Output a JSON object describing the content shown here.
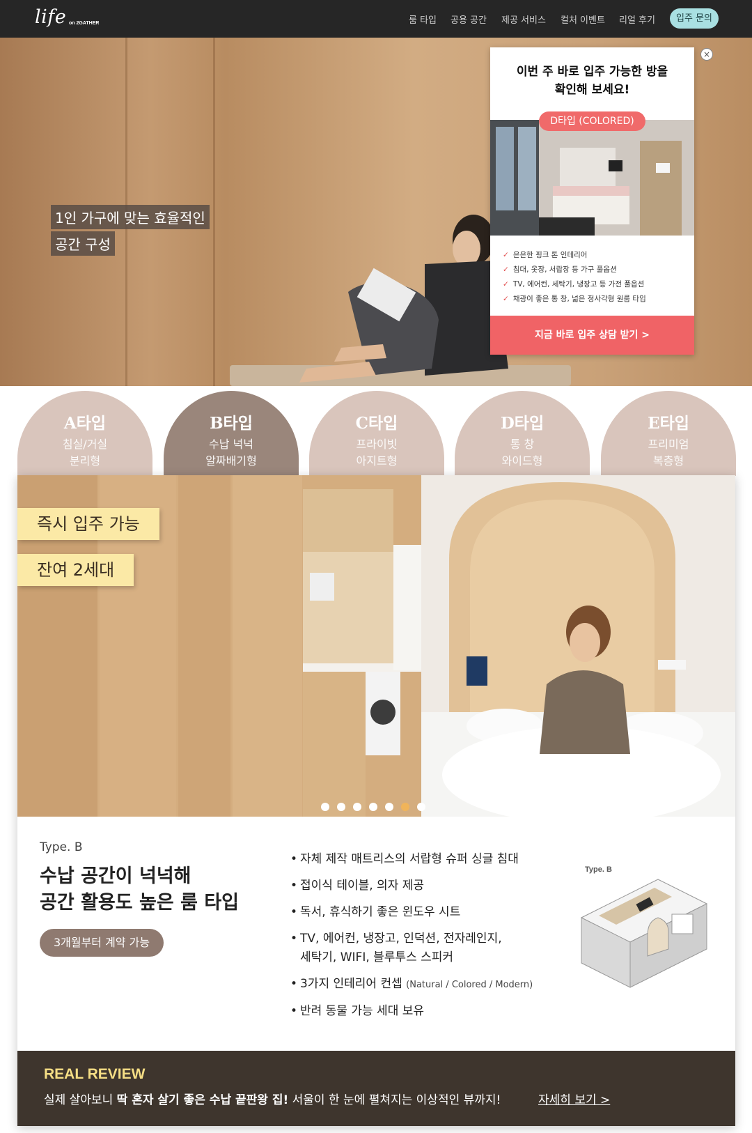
{
  "nav": {
    "logo": "life",
    "logo_sub": "on 2GATHER",
    "items": [
      "룸 타입",
      "공용 공간",
      "제공 서비스",
      "컬처 이벤트",
      "리얼 후기"
    ],
    "cta": "입주 문의"
  },
  "hero": {
    "caption_line1": "1인 가구에 맞는 효율적인",
    "caption_line2": "공간 구성"
  },
  "popup": {
    "close": "×",
    "title_line1": "이번 주 바로 입주 가능한 방을",
    "title_line2": "확인해 보세요!",
    "badge": "D타입 (COLORED)",
    "checks": [
      "은은한 핑크 톤 인테리어",
      "침대, 옷장, 서랍장 등 가구 풀옵션",
      "TV, 에어컨, 세탁기, 냉장고 등 가전 풀옵션",
      "채광이 좋은 통 창, 넓은 정사각형 원룸 타입"
    ],
    "cta": "지금 바로 입주 상담 받기 >"
  },
  "tabs": [
    {
      "title": "A타입",
      "line1": "침실/거실",
      "line2": "분리형",
      "color": "#d9c5bc",
      "active": false
    },
    {
      "title": "B타입",
      "line1": "수납 넉넉",
      "line2": "알짜배기형",
      "color": "#9a867b",
      "active": true
    },
    {
      "title": "C타입",
      "line1": "프라이빗",
      "line2": "아지트형",
      "color": "#d9c5bc",
      "active": false
    },
    {
      "title": "D타입",
      "line1": "통 창",
      "line2": "와이드형",
      "color": "#d9c5bc",
      "active": false
    },
    {
      "title": "E타입",
      "line1": "프리미엄",
      "line2": "복층형",
      "color": "#d9c5bc",
      "active": false
    }
  ],
  "slide": {
    "badge1": "즉시 입주 가능",
    "badge2": "잔여 2세대",
    "dots_total": 7,
    "active_dot": 6
  },
  "detail": {
    "type_label": "Type. B",
    "headline_line1": "수납 공간이 넉넉해",
    "headline_line2": "공간 활용도 높은 룸 타입",
    "contract_button": "3개월부터 계약 가능",
    "features": [
      "자체 제작 매트리스의 서랍형 슈퍼 싱글 침대",
      "접이식 테이블, 의자 제공",
      "독서, 휴식하기 좋은 윈도우 시트",
      "TV, 에어컨, 냉장고, 인덕션, 전자레인지,",
      "세탁기, WIFI, 블루투스 스피커",
      "3가지 인테리어 컨셉",
      "반려 동물 가능 세대 보유"
    ],
    "concept_note": "(Natural / Colored / Modern)",
    "floorplan_label": "Type. B"
  },
  "review": {
    "title": "REAL REVIEW",
    "text_prefix": "실제 살아보니 ",
    "text_bold": "딱 혼자 살기 좋은 수납 끝판왕 집!",
    "text_suffix": " 서울이 한 눈에 펼쳐지는 이상적인 뷰까지!",
    "link": "자세히 보기 >"
  },
  "colors": {
    "nav_bg": "#262626",
    "popup_accent": "#f06366",
    "tab_active": "#9a867b",
    "tab_inactive": "#d9c5bc",
    "badge_yellow": "#fbe9a6",
    "review_bg": "#3e352d",
    "review_title": "#f5de85"
  }
}
